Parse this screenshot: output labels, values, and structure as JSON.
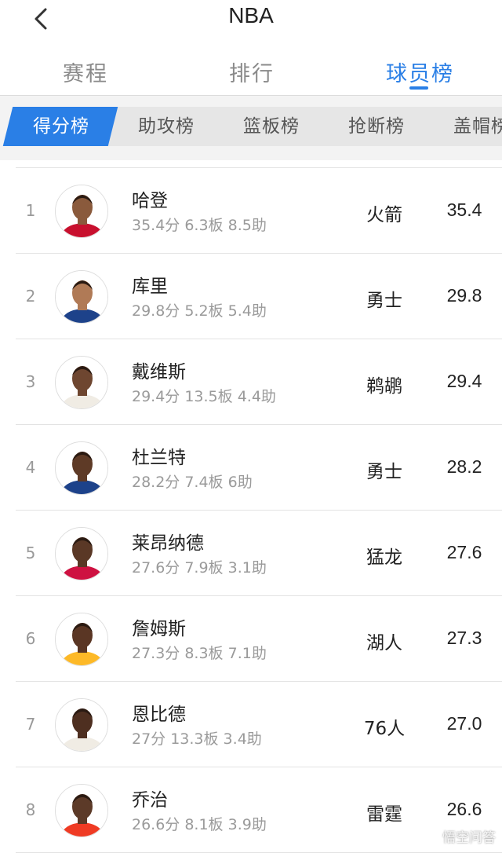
{
  "header": {
    "title": "NBA"
  },
  "tabs": [
    {
      "label": "赛程"
    },
    {
      "label": "排行"
    },
    {
      "label": "球员榜"
    }
  ],
  "subtabs": [
    {
      "label": "得分榜"
    },
    {
      "label": "助攻榜"
    },
    {
      "label": "篮板榜"
    },
    {
      "label": "抢断榜"
    },
    {
      "label": "盖帽榜"
    }
  ],
  "colors": {
    "accent": "#2a7fe6"
  },
  "players": [
    {
      "rank": "1",
      "name": "哈登",
      "stats": "35.4分 6.3板 8.5助",
      "team": "火箭",
      "score": "35.4",
      "jersey": "#c8102e",
      "skin": "#8a5a3c"
    },
    {
      "rank": "2",
      "name": "库里",
      "stats": "29.8分 5.2板 5.4助",
      "team": "勇士",
      "score": "29.8",
      "jersey": "#1d428a",
      "skin": "#b07a56"
    },
    {
      "rank": "3",
      "name": "戴维斯",
      "stats": "29.4分 13.5板 4.4助",
      "team": "鹈鹕",
      "score": "29.4",
      "jersey": "#f0ece4",
      "skin": "#6e4630"
    },
    {
      "rank": "4",
      "name": "杜兰特",
      "stats": "28.2分 7.4板 6助",
      "team": "勇士",
      "score": "28.2",
      "jersey": "#1d428a",
      "skin": "#5e3a26"
    },
    {
      "rank": "5",
      "name": "莱昂纳德",
      "stats": "27.6分 7.9板 3.1助",
      "team": "猛龙",
      "score": "27.6",
      "jersey": "#ce1141",
      "skin": "#5a3826"
    },
    {
      "rank": "6",
      "name": "詹姆斯",
      "stats": "27.3分 8.3板 7.1助",
      "team": "湖人",
      "score": "27.3",
      "jersey": "#fdb927",
      "skin": "#5a3624"
    },
    {
      "rank": "7",
      "name": "恩比德",
      "stats": "27分 13.3板 3.4助",
      "team": "76人",
      "score": "27.0",
      "jersey": "#f0ece4",
      "skin": "#4e2f20"
    },
    {
      "rank": "8",
      "name": "乔治",
      "stats": "26.6分 8.1板 3.9助",
      "team": "雷霆",
      "score": "26.6",
      "jersey": "#ef3b24",
      "skin": "#5c3a28"
    }
  ],
  "watermark": {
    "text": "悟空问答"
  }
}
